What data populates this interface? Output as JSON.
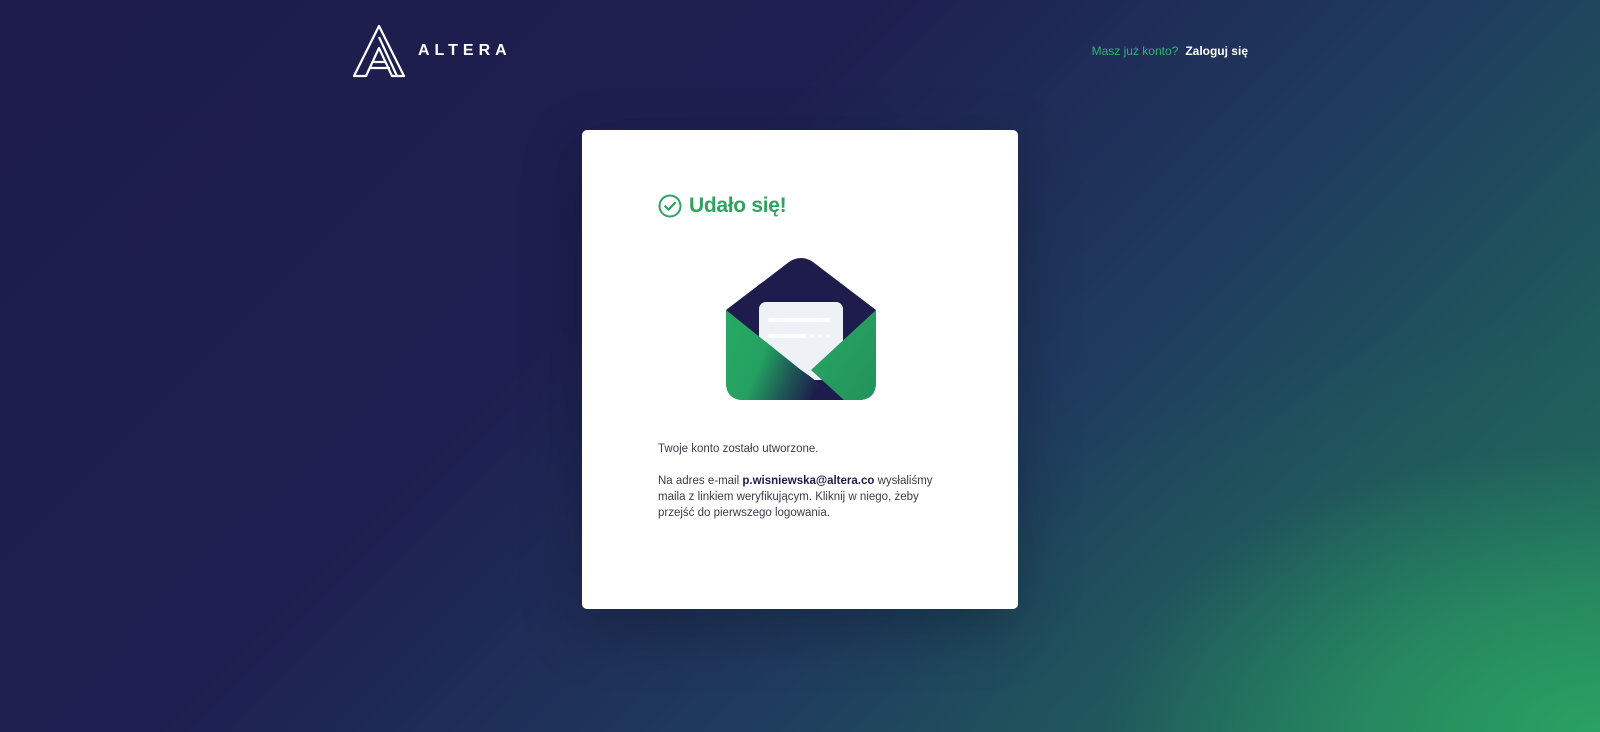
{
  "header": {
    "brand_name": "ALTERA",
    "account_question": "Masz już konto?",
    "login_label": "Zaloguj się"
  },
  "card": {
    "title": "Udało się!",
    "message_created": "Twoje konto zostało utworzone.",
    "message_prefix": "Na adres e-mail",
    "email": "p.wisniewska@altera.co",
    "message_suffix": "wysłaliśmy maila z linkiem weryfikującym. Kliknij w niego, żeby przejść do pierwszego logowania."
  },
  "colors": {
    "brand_navy": "#1d1c4c",
    "accent_green": "#2fa35f",
    "link_green": "#2fb574"
  },
  "icons": {
    "logo": "altera-logo-icon",
    "success": "check-circle-icon",
    "illustration": "open-envelope-icon"
  }
}
